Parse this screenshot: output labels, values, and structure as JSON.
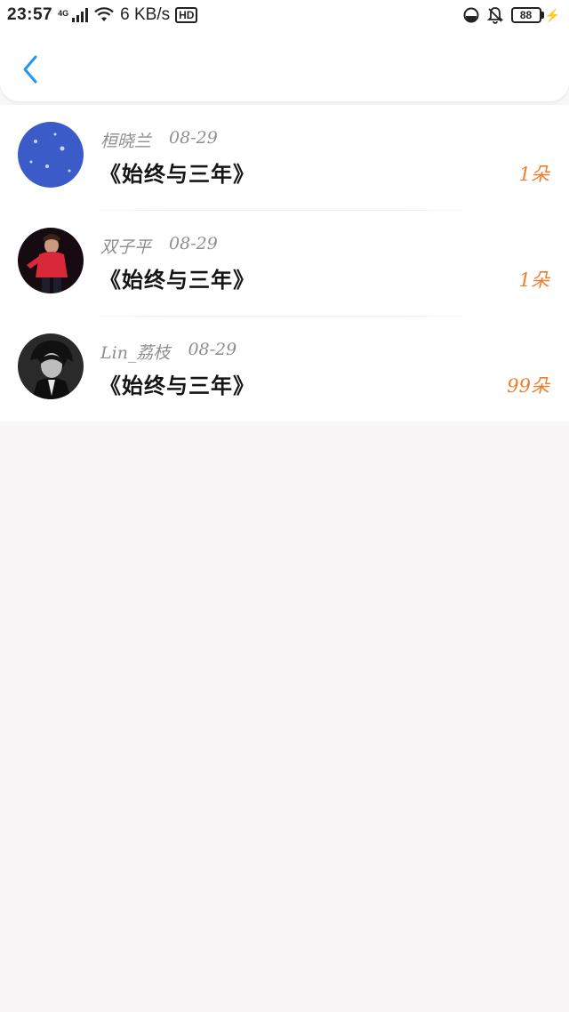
{
  "status_bar": {
    "time": "23:57",
    "network_type": "4G",
    "speed": "6 KB/s",
    "hd": "HD",
    "battery": "88"
  },
  "colors": {
    "accent": "#2196f3",
    "count": "#ef7d2e",
    "meta": "#8e8e8e"
  },
  "header": {
    "back_icon": "chevron-left-icon"
  },
  "gifts": [
    {
      "user": "桓晓兰",
      "date": "08-29",
      "title": "《始终与三年》",
      "count": "1朵",
      "avatar": "snowflake-blue"
    },
    {
      "user": "双子平",
      "date": "08-29",
      "title": "《始终与三年》",
      "count": "1朵",
      "avatar": "red-performer"
    },
    {
      "user": "Lin_荔枝",
      "date": "08-29",
      "title": "《始终与三年》",
      "count": "99朵",
      "avatar": "dark-anime"
    }
  ]
}
